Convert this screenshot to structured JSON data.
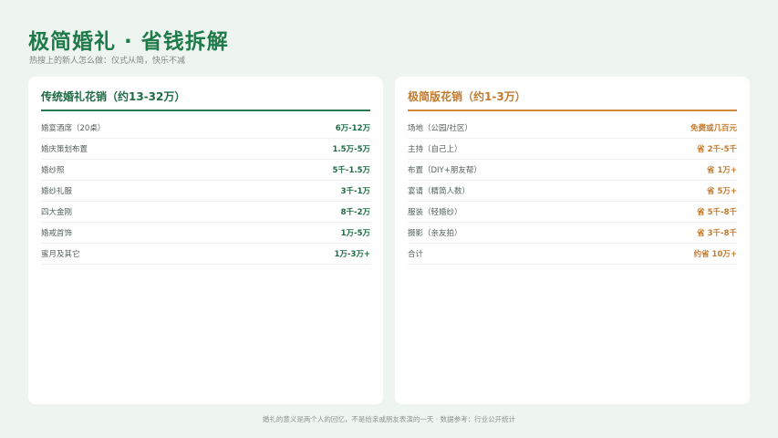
{
  "header": {
    "title": "极简婚礼 · 省钱拆解",
    "subtitle": "热搜上的新人怎么做：仪式从简，快乐不减"
  },
  "traditional": {
    "heading": "传统婚礼花销（约13-32万）",
    "rows": [
      {
        "label": "婚宴酒席（20桌）",
        "value": "6万-12万"
      },
      {
        "label": "婚庆策划布置",
        "value": "1.5万-5万"
      },
      {
        "label": "婚纱照",
        "value": "5千-1.5万"
      },
      {
        "label": "婚纱礼服",
        "value": "3千-1万"
      },
      {
        "label": "四大金刚",
        "value": "8千-2万"
      },
      {
        "label": "婚戒首饰",
        "value": "1万-5万"
      },
      {
        "label": "蜜月及其它",
        "value": "1万-3万+"
      }
    ]
  },
  "minimal": {
    "heading": "极简版花销（约1-3万）",
    "rows": [
      {
        "label": "场地（公园/社区）",
        "value": "免费或几百元"
      },
      {
        "label": "主持（自己上）",
        "value": "省 2千-5千"
      },
      {
        "label": "布置（DIY+朋友帮）",
        "value": "省 1万+"
      },
      {
        "label": "宴请（精简人数）",
        "value": "省 5万+"
      },
      {
        "label": "服装（轻婚纱）",
        "value": "省 5千-8千"
      },
      {
        "label": "摄影（亲友拍）",
        "value": "省 3千-8千"
      },
      {
        "label": "合计",
        "value": "约省 10万+"
      }
    ]
  },
  "footer": {
    "text": "婚礼的意义是两个人的回忆，不是给亲戚朋友表演的一天 · 数据参考：行业公开统计"
  },
  "colors": {
    "accent_green": "#1f7a4a",
    "accent_orange": "#c47a2c",
    "background": "#eef5f0"
  }
}
